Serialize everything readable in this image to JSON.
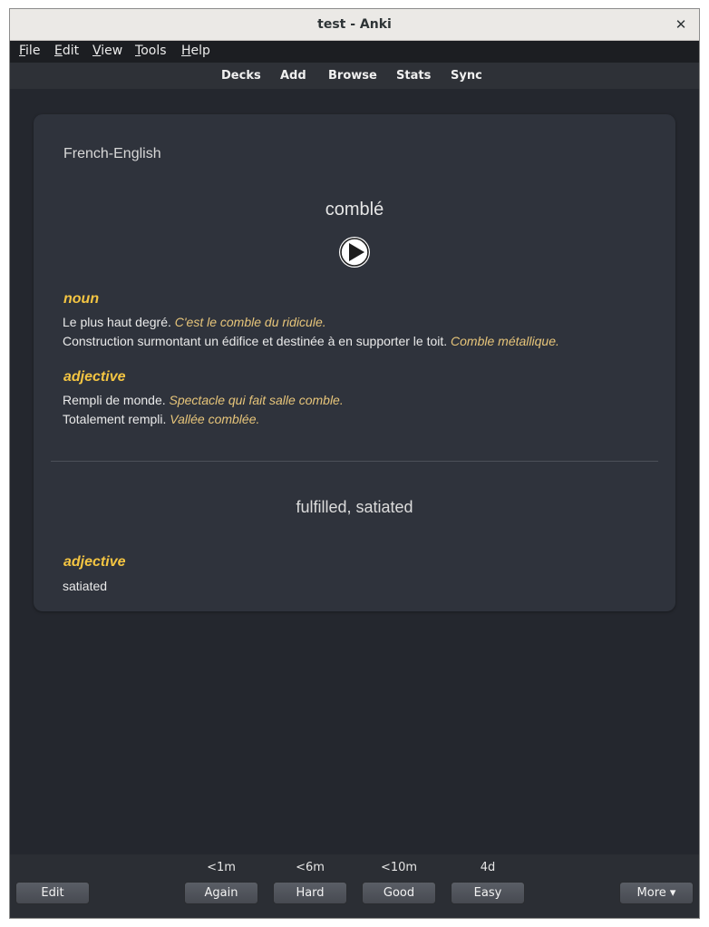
{
  "window": {
    "title": "test - Anki",
    "close_glyph": "✕"
  },
  "menubar": {
    "items": [
      {
        "label": "File",
        "mnemonic": "F",
        "rest": "ile"
      },
      {
        "label": "Edit",
        "mnemonic": "E",
        "rest": "dit"
      },
      {
        "label": "View",
        "mnemonic": "V",
        "rest": "iew"
      },
      {
        "label": "Tools",
        "mnemonic": "T",
        "rest": "ools"
      },
      {
        "label": "Help",
        "mnemonic": "H",
        "rest": "elp"
      }
    ]
  },
  "toolbar": {
    "decks": "Decks",
    "add": "Add",
    "browse": "Browse",
    "stats": "Stats",
    "sync": "Sync"
  },
  "card": {
    "deck_name": "French-English",
    "word": "comblé",
    "sections": [
      {
        "pos": "noun",
        "definitions": [
          {
            "text": "Le plus haut degré.",
            "example": "C'est le comble du ridicule."
          },
          {
            "text": "Construction surmontant un édifice et destinée à en supporter le toit.",
            "example": "Comble métallique."
          }
        ]
      },
      {
        "pos": "adjective",
        "definitions": [
          {
            "text": "Rempli de monde.",
            "example": "Spectacle qui fait salle comble."
          },
          {
            "text": "Totalement rempli.",
            "example": "Vallée comblée."
          }
        ]
      }
    ],
    "answer": "fulfilled, satiated",
    "answer_sections": [
      {
        "pos": "adjective",
        "definitions": [
          {
            "text": "satiated",
            "example": ""
          }
        ]
      }
    ]
  },
  "review_bar": {
    "edit": "Edit",
    "more": "More ▾",
    "answers": [
      {
        "label": "Again",
        "interval": "<1m"
      },
      {
        "label": "Hard",
        "interval": "<6m"
      },
      {
        "label": "Good",
        "interval": "<10m"
      },
      {
        "label": "Easy",
        "interval": "4d"
      }
    ]
  },
  "colors": {
    "background": "#24272e",
    "card": "#2f333c",
    "part_of_speech": "#f4c542",
    "example": "#e7c57a"
  },
  "icons": {
    "play": "play-icon",
    "close": "close-icon"
  }
}
